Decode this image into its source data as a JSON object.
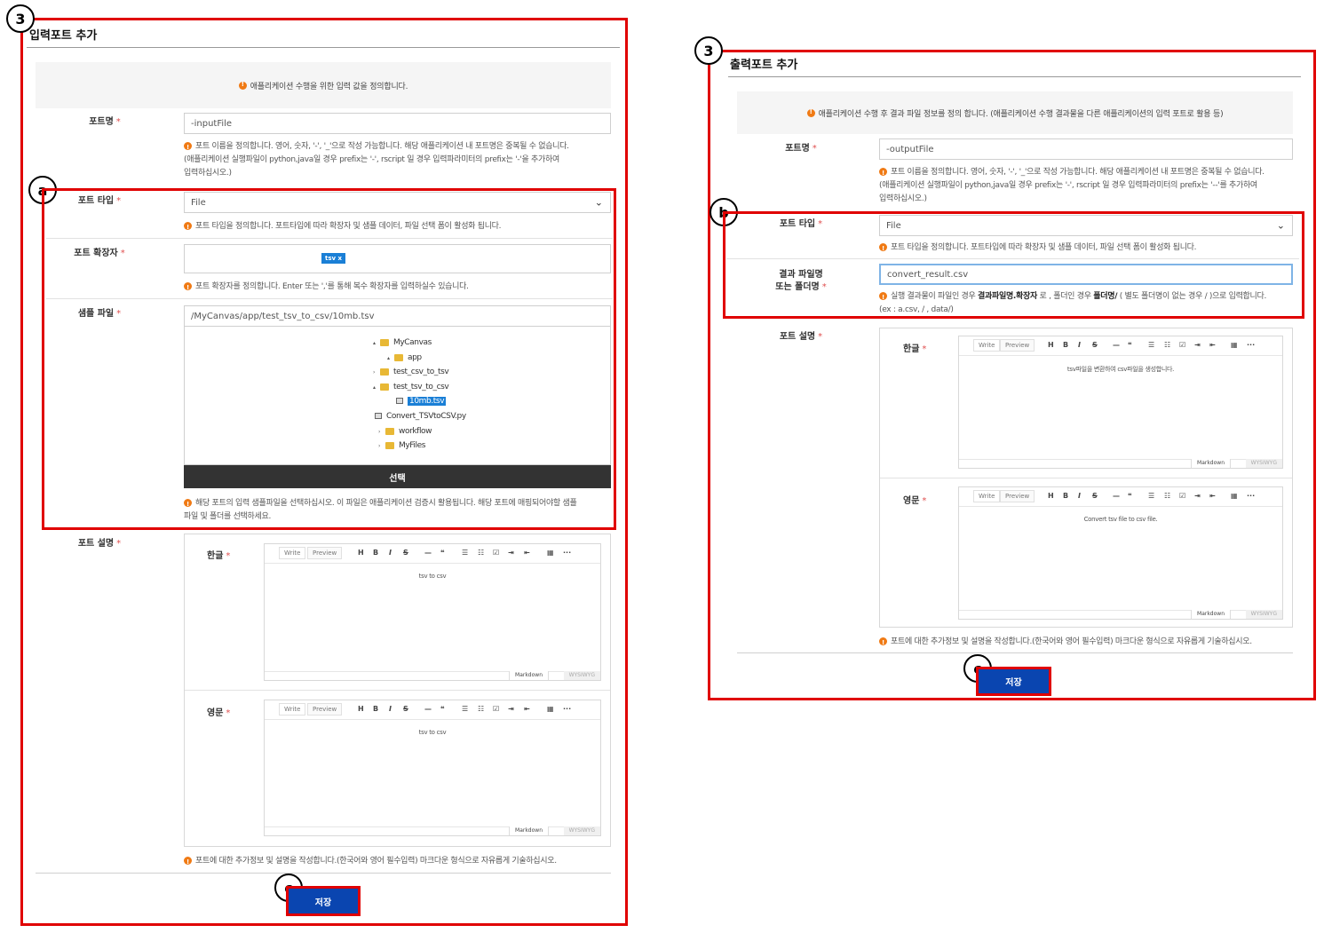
{
  "markers": {
    "three": "3",
    "a": "a",
    "b": "b",
    "c": "c"
  },
  "left": {
    "title": "입력포트 추가",
    "info": "애플리케이션 수행을 위한 입력 값을 정의합니다.",
    "port_name_label": "포트명",
    "port_name_value": "-inputFile",
    "port_name_help_1": "포트 이름을 정의합니다. 영어, 숫자, '-', '_'으로 작성 가능합니다. 해당 애플리케이션 내 포트명은 중복될 수 없습니다.",
    "port_name_help_2": "(애플리케이션 실행파일이 python,java일 경우 prefix는 '-', rscript 일 경우 입력파라미터의 prefix는 '-'을 추가하여",
    "port_name_help_3": "입력하십시오.)",
    "port_type_label": "포트 타입",
    "port_type_value": "File",
    "port_type_help": "포트 타입을 정의합니다. 포트타입에 따라 확장자 및 샘플 데이터, 파일 선택 폼이 활성화 됩니다.",
    "port_ext_label": "포트 확장자",
    "port_ext_tag": "tsv x",
    "port_ext_help": "포트 확장자를 정의합니다. Enter 또는 ','를 통해 복수 확장자를 입력하실수 있습니다.",
    "sample_label": "샘플 파일",
    "sample_path": "/MyCanvas/app/test_tsv_to_csv/10mb.tsv",
    "tree": [
      {
        "name": "MyCanvas",
        "type": "folder",
        "caret": "▴"
      },
      {
        "name": "app",
        "type": "folder",
        "caret": "▴"
      },
      {
        "name": "test_csv_to_tsv",
        "type": "folder",
        "caret": "›"
      },
      {
        "name": "test_tsv_to_csv",
        "type": "folder",
        "caret": "▴"
      },
      {
        "name": "10mb.tsv",
        "type": "file",
        "caret": ""
      },
      {
        "name": "Convert_TSVtoCSV.py",
        "type": "file",
        "caret": ""
      },
      {
        "name": "workflow",
        "type": "folder",
        "caret": "›"
      },
      {
        "name": "MyFiles",
        "type": "folder",
        "caret": "›"
      }
    ],
    "select_button": "선택",
    "sample_help_1": "해당 포트의 입력 샘플파일을 선택하십시오. 이 파일은 애플리케이션 검증시 활용됩니다. 해당 포트에 매핑되어야할 샘플",
    "sample_help_2": "파일 및 폴더를 선택하세요.",
    "desc_label": "포트 설명",
    "ko_label": "한글",
    "en_label": "영문",
    "ko_content": "tsv to csv",
    "en_content": "tsv to csv",
    "desc_help": "포트에 대한 추가정보 및 설명을 작성합니다.(한국어와 영어 필수입력) 마크다운 형식으로 자유롭게 기술하십시오.",
    "save": "저장"
  },
  "right": {
    "title": "출력포트 추가",
    "info": "애플리케이션 수행 후 결과 파일 정보를 정의 합니다. (애플리케이션 수행 결과물을 다른 애플리케이션의 입력 포트로 활용 등)",
    "port_name_label": "포트명",
    "port_name_value": "-outputFile",
    "port_name_help_1": "포트 이름을 정의합니다. 영어, 숫자, '-', '_'으로 작성 가능합니다. 해당 애플리케이션 내 포트명은 중복될 수 없습니다.",
    "port_name_help_2": "(애플리케이션 실행파일이 python,java일 경우 prefix는 '-', rscript 일 경우 입력파라미터의 prefix는 '--'를 추가하여",
    "port_name_help_3": "입력하십시오.)",
    "port_type_label": "포트 타입",
    "port_type_value": "File",
    "port_type_help": "포트 타입을 정의합니다. 포트타입에 따라 확장자 및 샘플 데이터, 파일 선택 폼이 활성화 됩니다.",
    "result_label_1": "결과 파일명",
    "result_label_2": "또는 폴더명",
    "result_value": "convert_result.csv",
    "result_help_pre": "실행 결과물이 파일인 경우 ",
    "result_help_b1": "결과파일명.확장자",
    "result_help_mid": " 로 , 폴더인 경우 ",
    "result_help_b2": "폴더명/",
    "result_help_post": " ( 별도 폴더명이 없는 경우 / )으로 입력합니다.",
    "result_help_2": "(ex :   a.csv, / , data/)",
    "desc_label": "포트 설명",
    "ko_label": "한글",
    "en_label": "영문",
    "ko_content": "tsv파일을 변환하여 csv파일을 생성합니다.",
    "en_content": "Convert tsv file to csv file.",
    "desc_help": "포트에 대한 추가정보 및 설명을 작성합니다.(한국어와 영어 필수입력) 마크다운 형식으로 자유롭게 기술하십시오.",
    "save": "저장"
  },
  "editor": {
    "write_tab": "Write",
    "preview_tab": "Preview",
    "tools": [
      "H",
      "B",
      "I",
      "S",
      "—",
      "❝",
      "☰",
      "☷",
      "☑",
      "⇥",
      "⇤",
      "▦",
      "···"
    ],
    "markdown": "Markdown",
    "wysiwyg": "WYSIWYG"
  },
  "colors": {
    "annotation_red": "#e00000",
    "save_blue": "#0a45b0",
    "info_orange": "#f07a14",
    "tag_blue": "#1a7fd6"
  }
}
